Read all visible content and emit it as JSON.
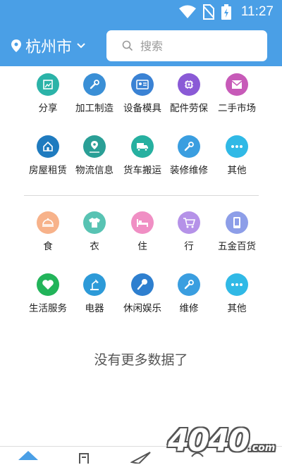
{
  "status_bar": {
    "time": "11:27"
  },
  "header": {
    "city": "杭州市",
    "search_placeholder": "搜索"
  },
  "section1": [
    {
      "label": "分享",
      "icon": "share-image-icon",
      "color": "#2bb3a8"
    },
    {
      "label": "加工制造",
      "icon": "wrench-icon",
      "color": "#3a8fd6"
    },
    {
      "label": "设备模具",
      "icon": "id-card-icon",
      "color": "#3a82d4"
    },
    {
      "label": "配件劳保",
      "icon": "chip-icon",
      "color": "#8a5ad6"
    },
    {
      "label": "二手市场",
      "icon": "envelope-icon",
      "color": "#c75ab8"
    },
    {
      "label": "房屋租赁",
      "icon": "house-icon",
      "color": "#1f7bbf"
    },
    {
      "label": "物流信息",
      "icon": "location-route-icon",
      "color": "#2a9f96"
    },
    {
      "label": "货车搬运",
      "icon": "truck-icon",
      "color": "#26b0a0"
    },
    {
      "label": "装修维修",
      "icon": "wrench-icon",
      "color": "#3a9ee0"
    },
    {
      "label": "其他",
      "icon": "more-dots-icon",
      "color": "#30b9e6"
    }
  ],
  "section2": [
    {
      "label": "食",
      "icon": "dish-icon",
      "color": "#f7b28a"
    },
    {
      "label": "衣",
      "icon": "tshirt-icon",
      "color": "#58c3b3"
    },
    {
      "label": "住",
      "icon": "bed-icon",
      "color": "#f08fc4"
    },
    {
      "label": "行",
      "icon": "cart-icon",
      "color": "#b592e8"
    },
    {
      "label": "五金百货",
      "icon": "phone-icon",
      "color": "#8d9ee8"
    },
    {
      "label": "生活服务",
      "icon": "heart-icon",
      "color": "#22b45a"
    },
    {
      "label": "电器",
      "icon": "desk-lamp-icon",
      "color": "#2d9ad8"
    },
    {
      "label": "休闲娱乐",
      "icon": "microphone-icon",
      "color": "#2e7fcf"
    },
    {
      "label": "维修",
      "icon": "wrench-icon",
      "color": "#3a9ee0"
    },
    {
      "label": "其他",
      "icon": "more-dots-icon",
      "color": "#30b9e6"
    }
  ],
  "footer_text": "没有更多数据了",
  "watermark": {
    "main": "4040",
    "suffix": ".com"
  },
  "colors": {
    "primary": "#4a9fe6"
  }
}
